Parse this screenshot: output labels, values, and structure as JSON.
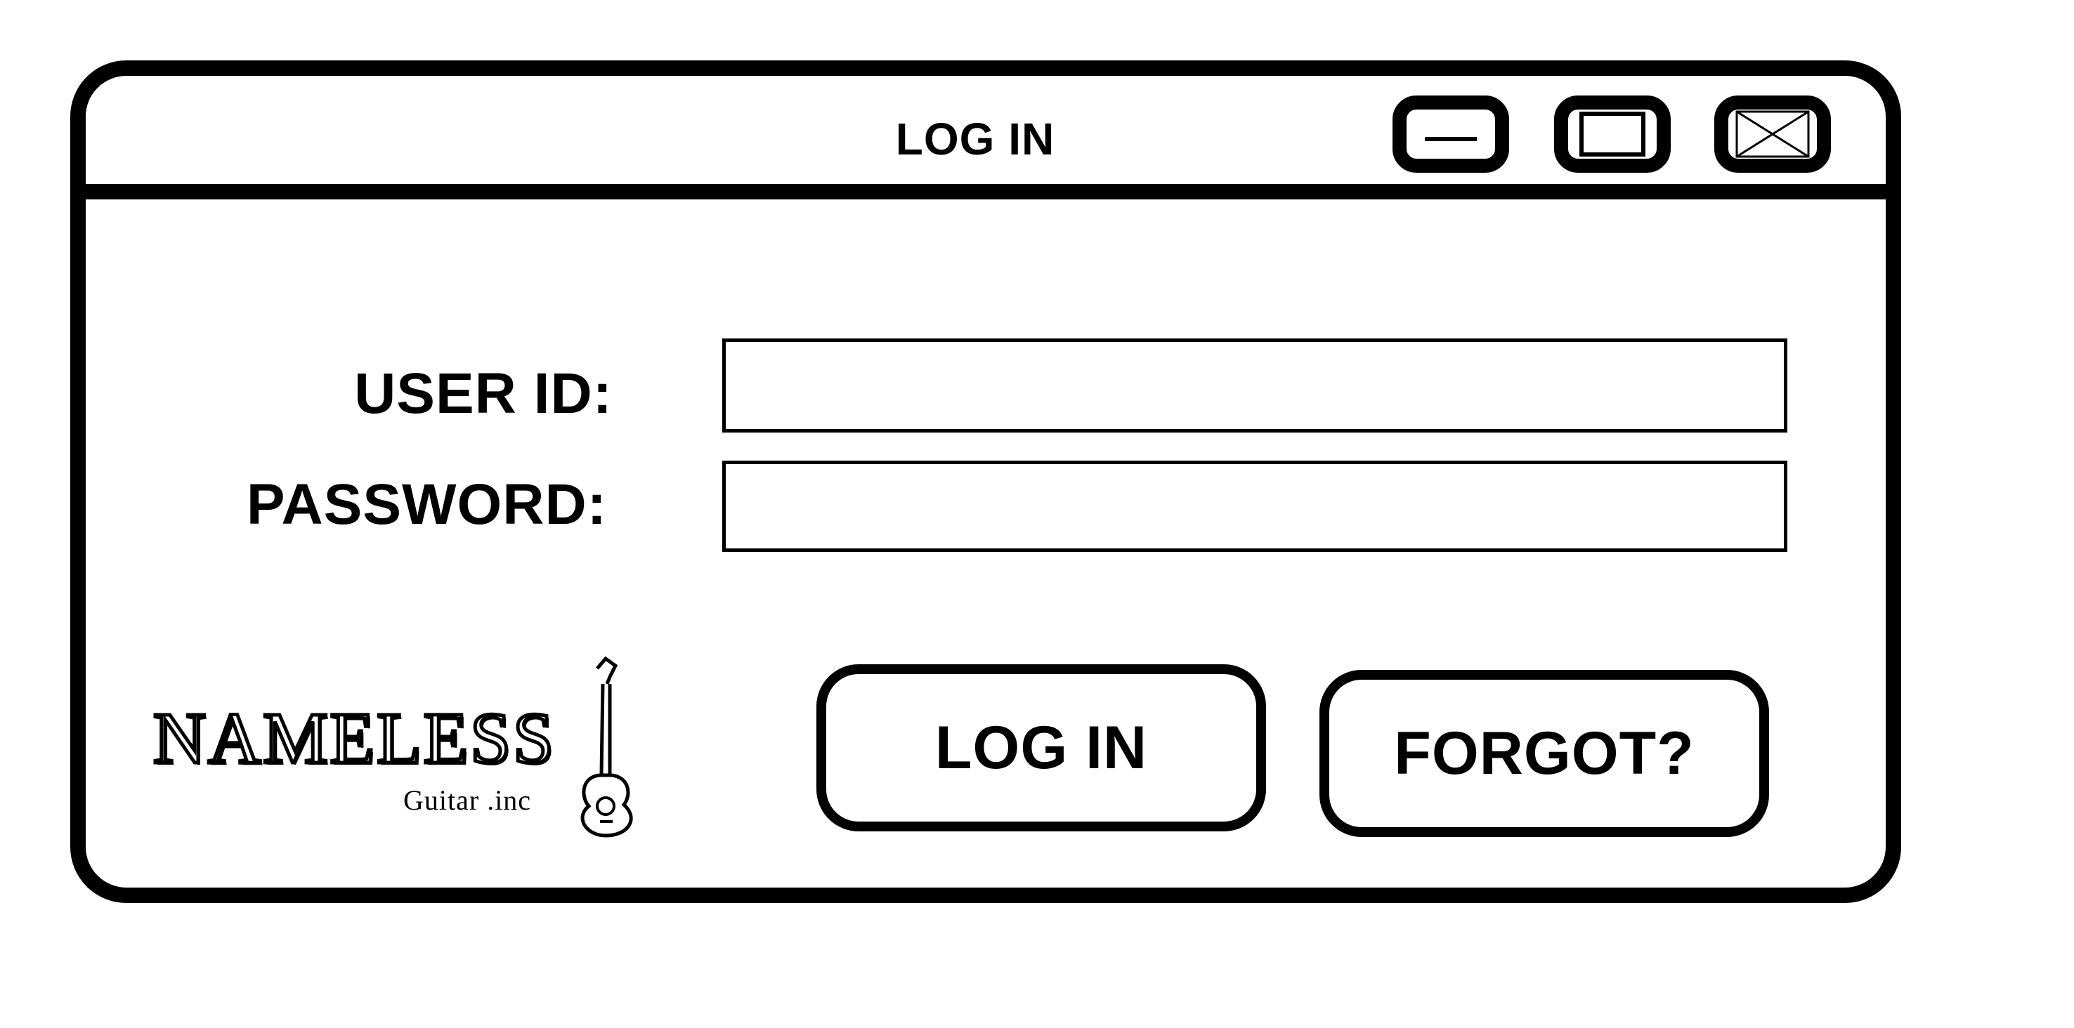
{
  "window": {
    "title": "LOG IN",
    "controls": {
      "minimize_icon": "minimize-icon",
      "maximize_icon": "maximize-icon",
      "close_icon": "close-icon"
    }
  },
  "form": {
    "user_id_label": "USER ID:",
    "user_id_value": "",
    "password_label": "PASSWORD:",
    "password_value": ""
  },
  "buttons": {
    "login_label": "LOG IN",
    "forgot_label": "FORGOT?"
  },
  "logo": {
    "name": "NAMELESS",
    "subtitle": "Guitar .inc",
    "icon": "guitar-icon"
  },
  "colors": {
    "foreground": "#000000",
    "background": "#ffffff"
  }
}
